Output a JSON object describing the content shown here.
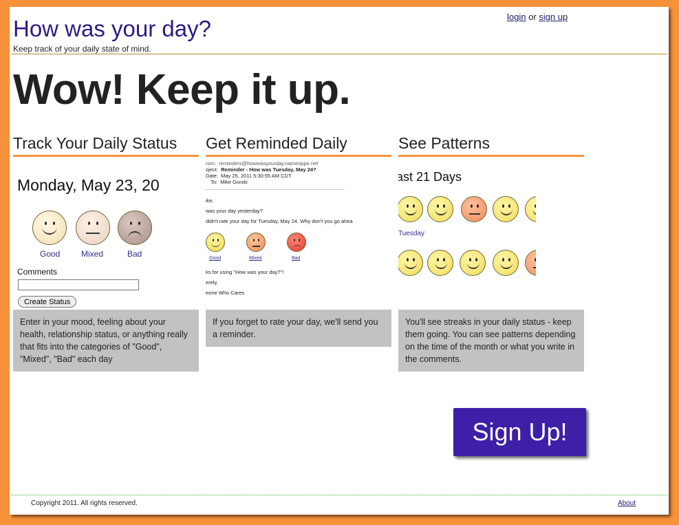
{
  "header": {
    "title": "How was your day?",
    "tagline": "Keep track of your daily state of mind.",
    "login_label": "login",
    "or_text": "or",
    "signup_link_label": "sign up"
  },
  "hero": "Wow! Keep it up.",
  "features": [
    {
      "heading": "Track Your Daily Status",
      "description": "Enter in your mood, feeling about your health, relationship status, or anything really that fits into the categories of \"Good\", \"Mixed\", \"Bad\" each day",
      "screenshot": {
        "date": "Monday, May 23, 20",
        "moods": [
          "Good",
          "Mixed",
          "Bad"
        ],
        "comments_label": "Comments",
        "comments_value": "",
        "button_label": "Create Status"
      }
    },
    {
      "heading": "Get Reminded Daily",
      "description": "If you forget to rate your day, we'll send you a reminder.",
      "screenshot": {
        "from_label": "rom:",
        "from_value": "reminders@howwasyourday.nameoppe.net",
        "subject_label": "oject:",
        "subject_value": "Reminder - How was Tuesday, May 24?",
        "date_label": "Date:",
        "date_value": "May 25, 2011 5:30:55 AM CDT",
        "to_label": "To:",
        "to_value": "Mike Gorski",
        "greeting": "ike,",
        "line1": "was your day yesterday?",
        "line2": "didn't rate your day for Tuesday, May 24. Why don't you go ahea",
        "moods": [
          "Good",
          "Mixed",
          "Bad"
        ],
        "thanks": "ks for using \"How was your day?\"!",
        "sincerely": "erely,",
        "signature": "eone Who Cares"
      }
    },
    {
      "heading": "See Patterns",
      "description": "You'll see streaks in your daily status - keep them going. You can see patterns depending on the time of the month or what you write in the comments.",
      "screenshot": {
        "title": "ast 21 Days",
        "day_label": "Tuesday"
      }
    }
  ],
  "signup_button": "Sign Up!",
  "footer": {
    "copyright": "Copyright 2011. All rights reserved.",
    "about": "About"
  },
  "colors": {
    "background": "#f7923a",
    "accent": "#3d1fa8",
    "title": "#2d1a86",
    "description_bg": "#c2c2c2",
    "smiley_yellow": "#f5e27a",
    "smiley_orange": "#f3916a"
  }
}
